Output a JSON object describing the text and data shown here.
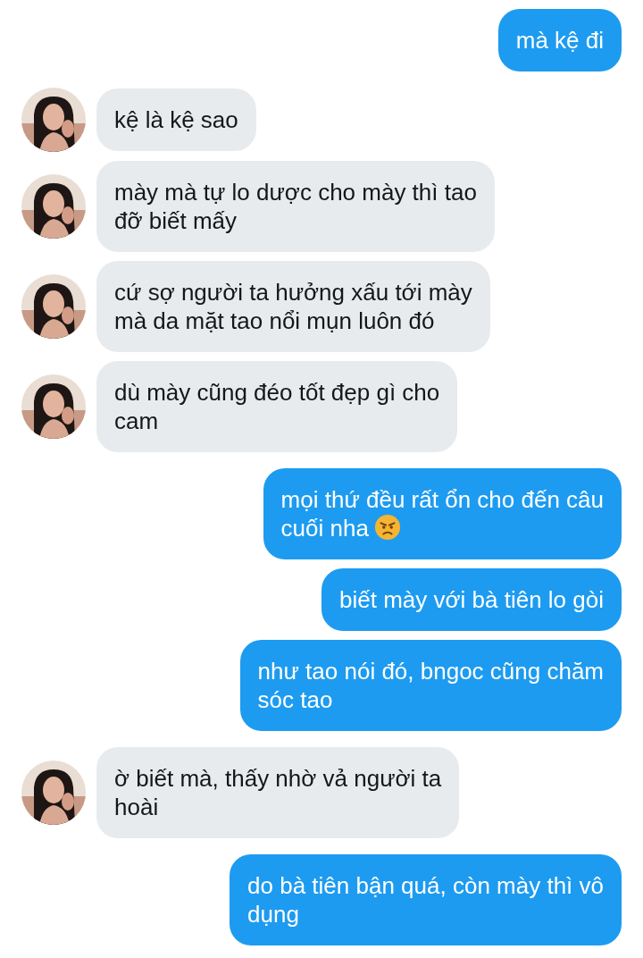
{
  "messages": [
    {
      "kind": "sent",
      "text": "mà kệ đi"
    },
    {
      "kind": "received",
      "text": "kệ là kệ sao"
    },
    {
      "kind": "received",
      "text": "mày mà tự lo dược cho mày thì tao\nđỡ biết mấy"
    },
    {
      "kind": "received",
      "text": "cứ sợ người ta hưởng xấu tới mày\nmà da mặt tao nổi mụn luôn đó"
    },
    {
      "kind": "received",
      "text": "dù mày cũng đéo tốt đẹp gì cho\ncam"
    },
    {
      "kind": "sent",
      "text": "mọi thứ đều rất ổn cho đến câu\ncuối nha",
      "trailing_icon": {
        "kind": "angry"
      }
    },
    {
      "kind": "sent",
      "text": "biết mày với bà tiên lo gòi"
    },
    {
      "kind": "sent",
      "text": "như tao nói đó, bngoc cũng chăm\nsóc tao"
    },
    {
      "kind": "received",
      "text": "ờ biết mà, thấy nhờ vả người ta\nhoài"
    },
    {
      "kind": "sent",
      "text": "do bà tiên bận quá, còn mày thì vô\ndụng"
    }
  ]
}
